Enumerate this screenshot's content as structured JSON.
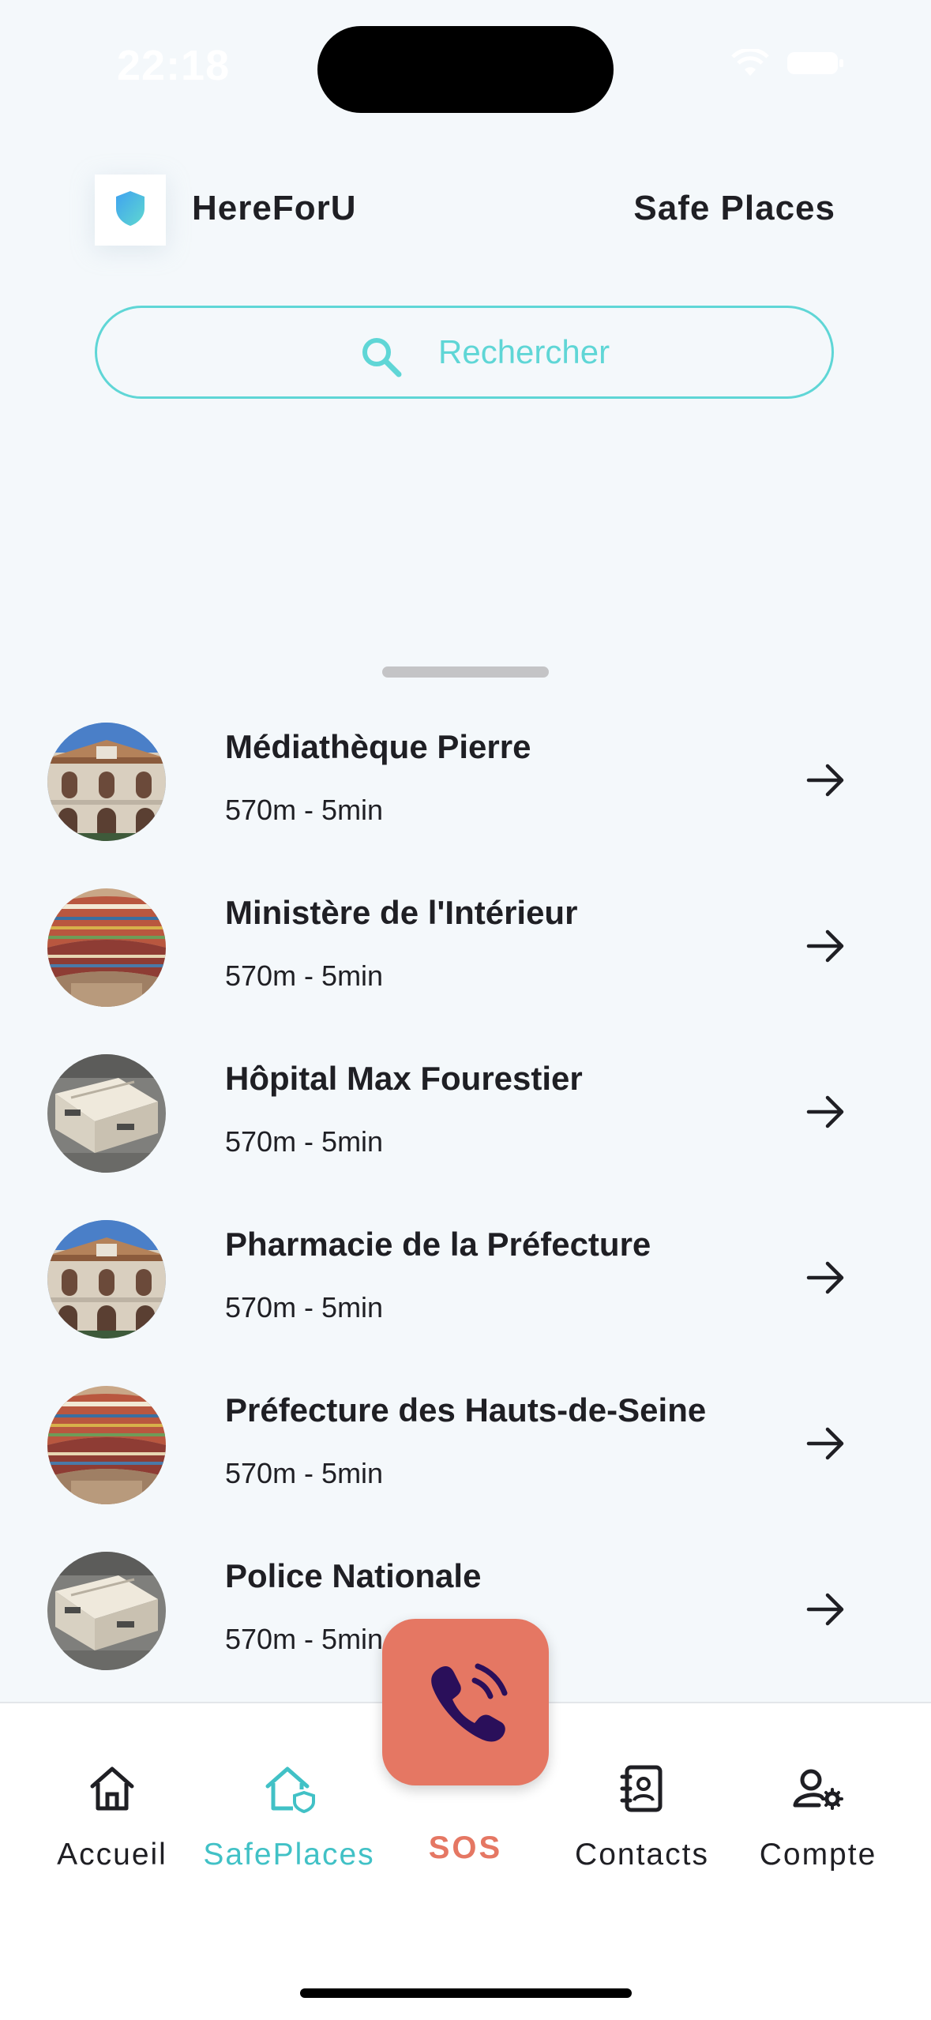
{
  "status_bar": {
    "time": "22:18"
  },
  "header": {
    "app_name": "HereForU",
    "page_title": "Safe Places"
  },
  "search": {
    "placeholder": "Rechercher"
  },
  "places": [
    {
      "name": "Médiathèque Pierre",
      "meta": "570m - 5min",
      "image": "building-facade"
    },
    {
      "name": "Ministère de l'Intérieur",
      "meta": "570m - 5min",
      "image": "library-shelves"
    },
    {
      "name": "Hôpital Max Fourestier",
      "meta": "570m - 5min",
      "image": "archive-boxes"
    },
    {
      "name": "Pharmacie de la Préfecture",
      "meta": "570m - 5min",
      "image": "building-facade"
    },
    {
      "name": "Préfecture des Hauts-de-Seine",
      "meta": "570m - 5min",
      "image": "library-shelves"
    },
    {
      "name": "Police Nationale",
      "meta": "570m - 5min",
      "image": "archive-boxes"
    }
  ],
  "nav": {
    "items": [
      {
        "label": "Accueil",
        "icon": "home-icon"
      },
      {
        "label": "SafePlaces",
        "icon": "safe-home-icon",
        "active": true
      },
      {
        "label": "SOS",
        "icon": "phone-call-icon"
      },
      {
        "label": "Contacts",
        "icon": "contacts-icon"
      },
      {
        "label": "Compte",
        "icon": "user-settings-icon"
      }
    ]
  },
  "colors": {
    "accent": "#41c1c6",
    "search_border": "#5fd6d6",
    "sos": "#e57763",
    "sos_icon": "#2a0f5a",
    "background": "#f4f8fb"
  }
}
